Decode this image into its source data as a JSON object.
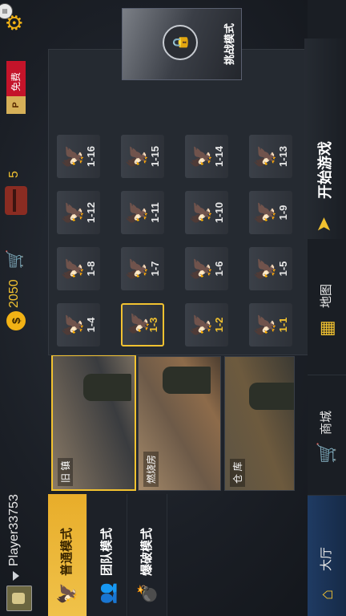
{
  "player": {
    "name": "Player33753"
  },
  "currency": {
    "coins": "2050",
    "bombs": "5"
  },
  "promo": {
    "free_label": "免费"
  },
  "tabs": [
    {
      "label": "普通模式",
      "icon": "eagle-icon",
      "active": true
    },
    {
      "label": "团队模式",
      "icon": "team-icon",
      "active": false
    },
    {
      "label": "爆破模式",
      "icon": "bomb-icon",
      "active": false
    }
  ],
  "maps": [
    {
      "name": "旧 镇",
      "selected": true
    },
    {
      "name": "燃烧房",
      "selected": false
    },
    {
      "name": "仓 库",
      "selected": false
    }
  ],
  "levels": [
    [
      "1-1",
      "1-2",
      "1-3",
      "1-4"
    ],
    [
      "1-5",
      "1-6",
      "1-7",
      "1-8"
    ],
    [
      "1-9",
      "1-10",
      "1-11",
      "1-12"
    ],
    [
      "1-13",
      "1-14",
      "1-15",
      "1-16"
    ]
  ],
  "level_state": {
    "unlocked": [
      "1-1",
      "1-2",
      "1-3"
    ],
    "selected": "1-3"
  },
  "challenge": {
    "label": "挑战模式"
  },
  "start": {
    "label": "开始游戏"
  },
  "nav": [
    {
      "label": "大厅",
      "icon": "home-icon",
      "active": true
    },
    {
      "label": "商城",
      "icon": "cart-icon",
      "active": false
    },
    {
      "label": "地图",
      "icon": "map-icon",
      "active": false
    }
  ],
  "colors": {
    "accent": "#f2c230",
    "active_nav": "#1f3b63"
  }
}
